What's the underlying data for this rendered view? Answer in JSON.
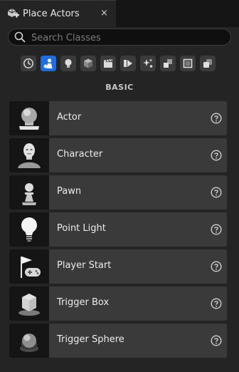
{
  "tab": {
    "title": "Place Actors",
    "close_glyph": "×",
    "icon": "place-actors-icon"
  },
  "search": {
    "placeholder": "Search Classes",
    "value": ""
  },
  "categories": [
    {
      "name": "recently-placed",
      "icon": "clock-icon",
      "active": false
    },
    {
      "name": "basic",
      "icon": "basic-actor-icon",
      "active": true
    },
    {
      "name": "lights",
      "icon": "light-bulb-icon",
      "active": false
    },
    {
      "name": "shapes",
      "icon": "cube-icon",
      "active": false
    },
    {
      "name": "cinematic",
      "icon": "clapperboard-icon",
      "active": false
    },
    {
      "name": "visual-effects",
      "icon": "play-box-icon",
      "active": false
    },
    {
      "name": "effects",
      "icon": "sparkle-icon",
      "active": false
    },
    {
      "name": "geometry",
      "icon": "volumes-icon",
      "active": false
    },
    {
      "name": "volumes",
      "icon": "square-frame-icon",
      "active": false
    },
    {
      "name": "all-classes",
      "icon": "stacked-layers-icon",
      "active": false
    }
  ],
  "section": {
    "label": "BASIC"
  },
  "items": [
    {
      "label": "Actor",
      "icon": "actor-sphere-icon"
    },
    {
      "label": "Character",
      "icon": "character-bust-icon"
    },
    {
      "label": "Pawn",
      "icon": "pawn-icon"
    },
    {
      "label": "Point Light",
      "icon": "point-light-bulb-icon"
    },
    {
      "label": "Player Start",
      "icon": "player-start-flag-icon"
    },
    {
      "label": "Trigger Box",
      "icon": "trigger-box-icon"
    },
    {
      "label": "Trigger Sphere",
      "icon": "trigger-sphere-icon"
    }
  ],
  "colors": {
    "accent": "#1f6ee0",
    "panel": "#242424",
    "row": "#3a3a3a",
    "background": "#151515"
  }
}
